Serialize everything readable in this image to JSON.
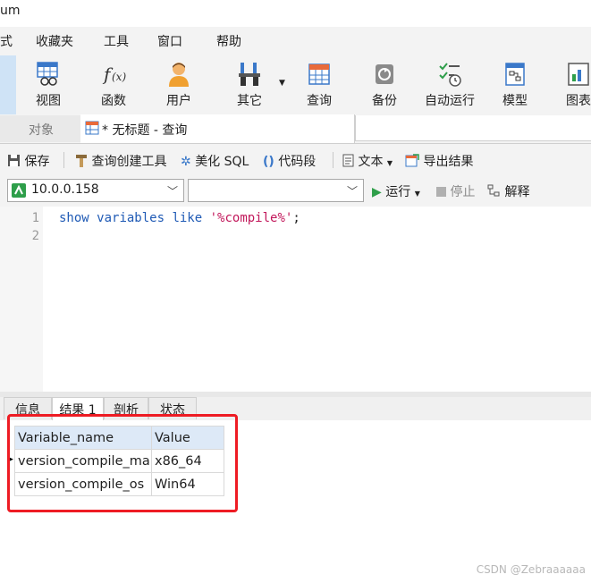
{
  "window": {
    "title_fragment": "um"
  },
  "menu": {
    "items": [
      "式",
      "收藏夹",
      "工具",
      "窗口",
      "帮助"
    ]
  },
  "toolbar": {
    "buttons": [
      {
        "label": "视图",
        "icon": "view-grid-icon"
      },
      {
        "label": "函数",
        "icon": "function-fx-icon"
      },
      {
        "label": "用户",
        "icon": "user-icon"
      },
      {
        "label": "其它",
        "icon": "tools-icon"
      },
      {
        "label": "查询",
        "icon": "query-table-icon"
      },
      {
        "label": "备份",
        "icon": "backup-icon"
      },
      {
        "label": "自动运行",
        "icon": "schedule-icon"
      },
      {
        "label": "模型",
        "icon": "model-icon"
      },
      {
        "label": "图表",
        "icon": "chart-icon"
      }
    ]
  },
  "tabs": {
    "objects": "对象",
    "query": "* 无标题 - 查询"
  },
  "editor_toolbar": {
    "save": "保存",
    "query_builder": "查询创建工具",
    "beautify": "美化 SQL",
    "snippet": "代码段",
    "text": "文本",
    "export": "导出结果"
  },
  "connection": {
    "host": "10.0.0.158",
    "database": "",
    "run": "运行",
    "stop": "停止",
    "explain": "解释"
  },
  "editor": {
    "line_numbers": [
      "1",
      "2"
    ],
    "line1": {
      "kw1": "show",
      "kw2": "variables",
      "kw3": "like",
      "str": "'%compile%'",
      "end": ";"
    }
  },
  "results": {
    "tabs": [
      "信息",
      "结果 1",
      "剖析",
      "状态"
    ],
    "active_tab": "结果 1",
    "columns": [
      "Variable_name",
      "Value"
    ],
    "rows": [
      [
        "version_compile_ma",
        "x86_64"
      ],
      [
        "version_compile_os",
        "Win64"
      ]
    ]
  },
  "watermark": "CSDN @Zebraaaaaa",
  "colors": {
    "highlight_box": "#ee1c24",
    "header_bg": "#dde9f7",
    "keyword": "#1f5ab5",
    "string": "#c2185b"
  }
}
